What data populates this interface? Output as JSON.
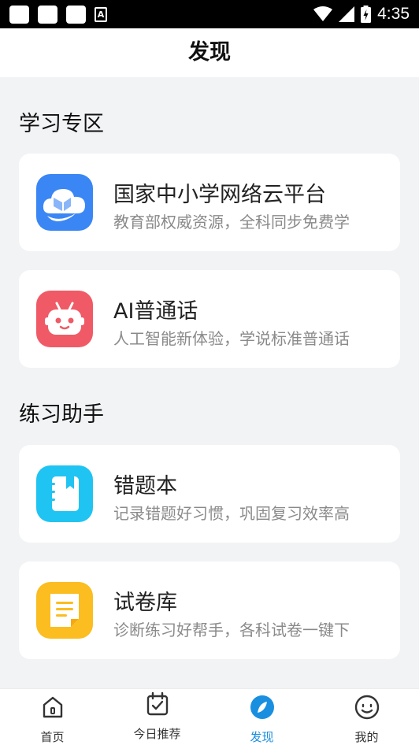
{
  "status_bar": {
    "time": "4:35",
    "notification_badge": "A"
  },
  "header": {
    "title": "发现"
  },
  "sections": [
    {
      "title": "学习专区",
      "items": [
        {
          "title": "国家中小学网络云平台",
          "subtitle": "教育部权威资源，全科同步免费学",
          "icon": "cloud-book-icon",
          "color": "#3a86f5"
        },
        {
          "title": "AI普通话",
          "subtitle": "人工智能新体验，学说标准普通话",
          "icon": "robot-icon",
          "color": "#f05a66"
        }
      ]
    },
    {
      "title": "练习助手",
      "items": [
        {
          "title": "错题本",
          "subtitle": "记录错题好习惯，巩固复习效率高",
          "icon": "notebook-icon",
          "color": "#1fc4f2"
        },
        {
          "title": "试卷库",
          "subtitle": "诊断练习好帮手，各科试卷一键下",
          "icon": "document-icon",
          "color": "#fbbd1f"
        }
      ]
    }
  ],
  "tab_bar": {
    "active_color": "#1a8fe0",
    "tabs": [
      {
        "label": "首页",
        "icon": "home-icon"
      },
      {
        "label": "今日推荐",
        "icon": "calendar-check-icon"
      },
      {
        "label": "发现",
        "icon": "compass-icon",
        "active": true
      },
      {
        "label": "我的",
        "icon": "smile-icon"
      }
    ]
  }
}
